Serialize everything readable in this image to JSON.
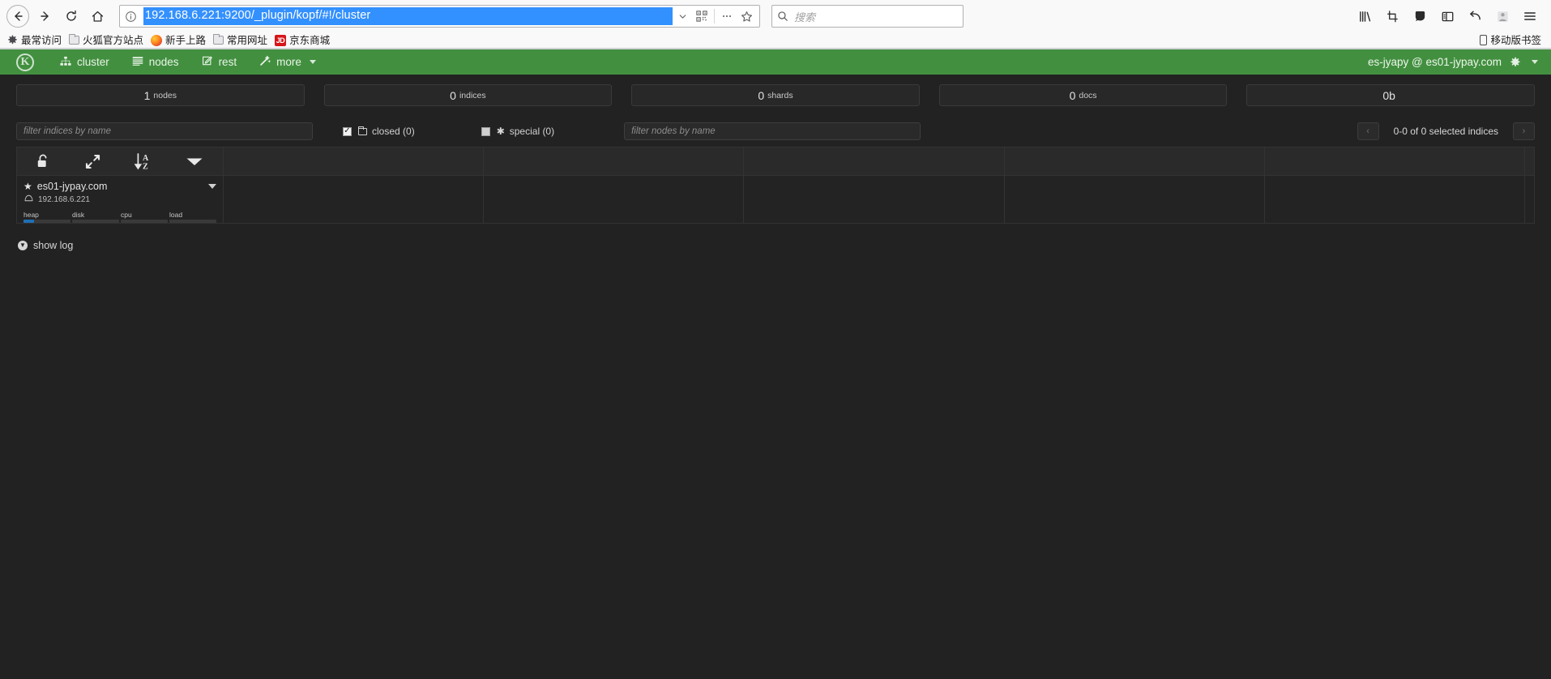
{
  "browser": {
    "url": "192.168.6.221:9200/_plugin/kopf/#!/cluster",
    "search_placeholder": "搜索",
    "nav": {
      "back": "back-arrow",
      "forward": "forward-arrow",
      "reload": "reload",
      "home": "home"
    },
    "url_actions": [
      "chevron-down-icon",
      "qr-reader-icon",
      "page-actions-icon",
      "bookmark-star-icon"
    ],
    "toolbar_right": [
      "library-icon",
      "screenshot-icon",
      "pocket-icon",
      "sidebar-icon",
      "sync-icon",
      "account-icon",
      "hamburger-menu-icon"
    ],
    "bookmarks": [
      {
        "label": "最常访问",
        "icon": "gear-icon"
      },
      {
        "label": "火狐官方站点",
        "icon": "folder-icon"
      },
      {
        "label": "新手上路",
        "icon": "firefox-icon"
      },
      {
        "label": "常用网址",
        "icon": "folder-icon"
      },
      {
        "label": "京东商城",
        "icon": "jd-icon"
      }
    ],
    "bookmarks_right": {
      "label": "移动版书签",
      "icon": "mobile-icon"
    }
  },
  "kopf": {
    "logo": "K",
    "nav_items": [
      {
        "label": "cluster",
        "icon": "sitemap-icon",
        "caret": false
      },
      {
        "label": "nodes",
        "icon": "list-icon",
        "caret": false
      },
      {
        "label": "rest",
        "icon": "edit-icon",
        "caret": false
      },
      {
        "label": "more",
        "icon": "magic-wand-icon",
        "caret": true
      }
    ],
    "cluster_label": "es-jyapy @ es01-jypay.com",
    "settings_icon": "gear-icon",
    "stats": [
      {
        "value": "1",
        "label": "nodes"
      },
      {
        "value": "0",
        "label": "indices"
      },
      {
        "value": "0",
        "label": "shards"
      },
      {
        "value": "0",
        "label": "docs"
      },
      {
        "value": "0b",
        "label": ""
      }
    ],
    "filters": {
      "indices_placeholder": "filter indices by name",
      "nodes_placeholder": "filter nodes by name",
      "closed": {
        "label": "closed (0)",
        "checked": true,
        "icon": "folder-icon"
      },
      "special": {
        "label": "special (0)",
        "checked": false,
        "icon": "asterisk-icon"
      }
    },
    "pager": {
      "prev": "‹",
      "next": "›",
      "label": "0-0 of 0 selected indices"
    },
    "table_tools": [
      {
        "name": "unlock-icon"
      },
      {
        "name": "expand-icon"
      },
      {
        "name": "sort-az-icon"
      },
      {
        "name": "caret-down-icon"
      }
    ],
    "node": {
      "name": "es01-jypay.com",
      "ip": "192.168.6.221",
      "master_icon": "star-icon",
      "node_icon": "disk-icon",
      "metrics": [
        {
          "label": "heap",
          "percent": 22
        },
        {
          "label": "disk",
          "percent": 0
        },
        {
          "label": "cpu",
          "percent": 0
        },
        {
          "label": "load",
          "percent": 0
        }
      ]
    },
    "show_log": {
      "label": "show log",
      "icon": "chevron-down-circle-icon"
    },
    "colors": {
      "navbar_green": "#42903f",
      "accent_blue": "#1f6fb5",
      "page_bg": "#222222"
    }
  }
}
